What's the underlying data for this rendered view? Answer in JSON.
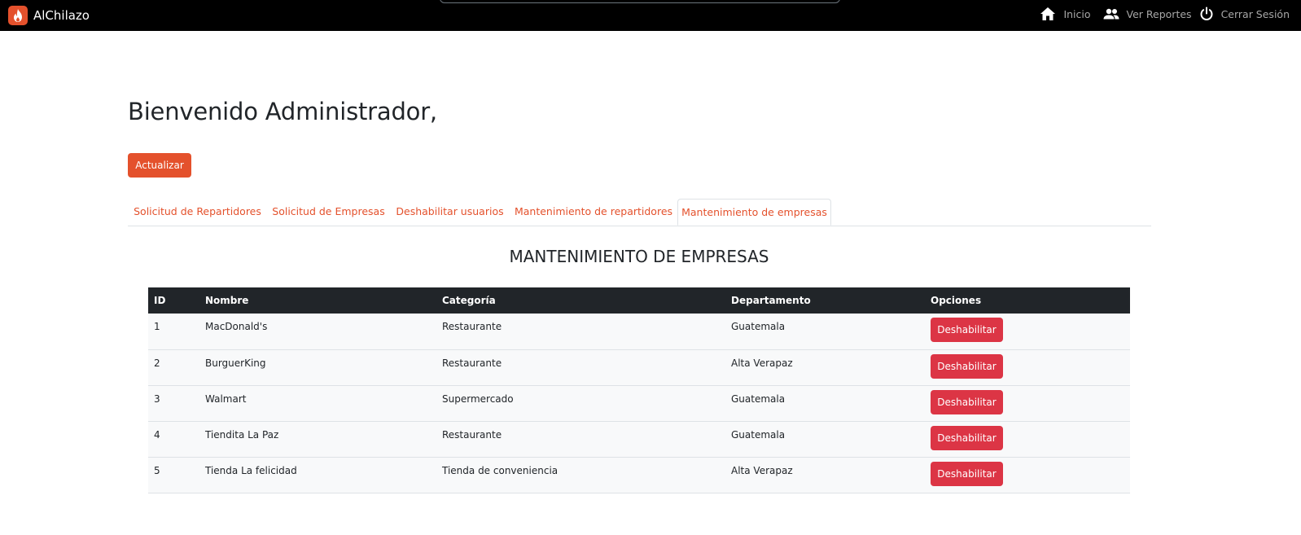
{
  "navbar": {
    "brand": "AlChilazo",
    "links": [
      {
        "label": "Inicio",
        "icon": "home-icon"
      },
      {
        "label": "Ver Reportes",
        "icon": "users-icon"
      },
      {
        "label": "Cerrar Sesión",
        "icon": "power-icon"
      }
    ]
  },
  "main": {
    "welcome": "Bienvenido Administrador,",
    "update_button": "Actualizar",
    "tabs": [
      {
        "label": "Solicitud de Repartidores"
      },
      {
        "label": "Solicitud de Empresas"
      },
      {
        "label": "Deshabilitar usuarios"
      },
      {
        "label": "Mantenimiento de repartidores"
      },
      {
        "label": "Mantenimiento de empresas",
        "active": true
      }
    ],
    "section_title": "MANTENIMIENTO DE EMPRESAS",
    "table": {
      "headers": [
        "ID",
        "Nombre",
        "Categoría",
        "Departamento",
        "Opciones"
      ],
      "rows": [
        {
          "id": "1",
          "nombre": "MacDonald's",
          "categoria": "Restaurante",
          "departamento": "Guatemala",
          "action": "Deshabilitar"
        },
        {
          "id": "2",
          "nombre": "BurguerKing",
          "categoria": "Restaurante",
          "departamento": "Alta Verapaz",
          "action": "Deshabilitar"
        },
        {
          "id": "3",
          "nombre": "Walmart",
          "categoria": "Supermercado",
          "departamento": "Guatemala",
          "action": "Deshabilitar"
        },
        {
          "id": "4",
          "nombre": "Tiendita La Paz",
          "categoria": "Restaurante",
          "departamento": "Guatemala",
          "action": "Deshabilitar"
        },
        {
          "id": "5",
          "nombre": "Tienda La felicidad",
          "categoria": "Tienda de conveniencia",
          "departamento": "Alta Verapaz",
          "action": "Deshabilitar"
        }
      ]
    }
  },
  "colors": {
    "navbar_bg": "#000000",
    "accent": "#e4512c",
    "danger": "#dc3545",
    "table_header_bg": "#212529"
  }
}
